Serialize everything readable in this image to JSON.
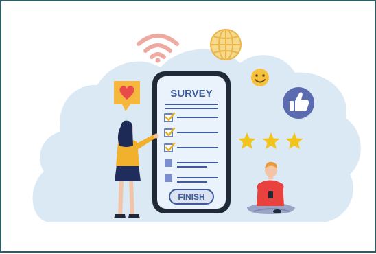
{
  "survey": {
    "title": "SURVEY",
    "finish_label": "FINISH",
    "items_checked": [
      true,
      true,
      true,
      false,
      false
    ]
  },
  "rating": {
    "stars": 3
  },
  "icons": [
    "wifi-icon",
    "globe-icon",
    "smiley-icon",
    "heart-icon",
    "thumbs-up-icon",
    "star-icon",
    "checkbox-icon"
  ],
  "colors": {
    "frame_border": "#2f5d62",
    "cloud": "#dbe9f5",
    "phone_body": "#1f2937",
    "phone_screen": "#eaf3fb",
    "survey_blue": "#3d5a9c",
    "finish_fill": "#dbe3f2",
    "check_yellow": "#e5b322",
    "star_yellow": "#f2c31b",
    "heart_bubble": "#f5b83d",
    "heart_red": "#e94b4b",
    "wifi_pink": "#eeaaa0",
    "globe_yellow": "#f6cf6a",
    "thumb_circle": "#5b6bb0",
    "woman_shirt": "#f2b12c",
    "woman_skirt": "#1f2d5c",
    "man_shirt": "#e8413e",
    "man_pants": "#9aa4c7"
  }
}
